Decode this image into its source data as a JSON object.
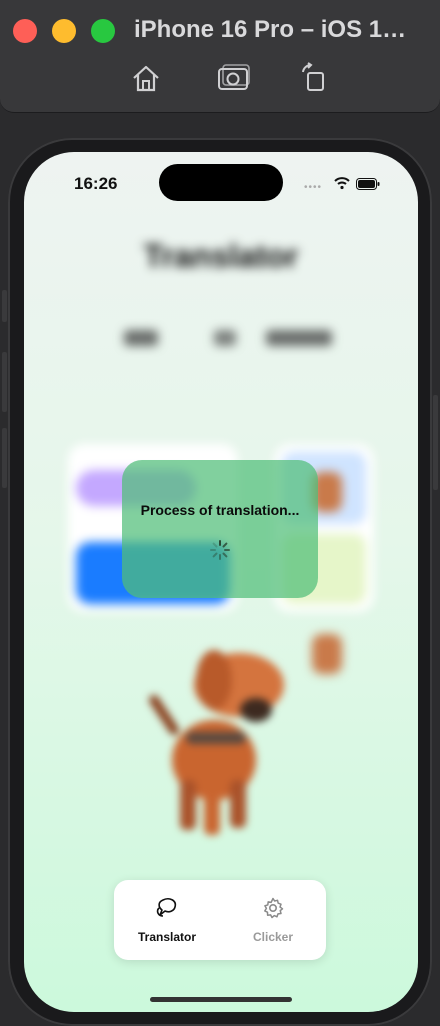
{
  "window": {
    "title": "iPhone 16 Pro – iOS 1…",
    "toolbar": {
      "home_icon": "home-icon",
      "screenshot_icon": "camera-icon",
      "rotate_icon": "rotate-icon"
    }
  },
  "status_bar": {
    "time": "16:26",
    "signal": "••••"
  },
  "background_screen": {
    "title": "Translator"
  },
  "overlay": {
    "message": "Process of translation..."
  },
  "tabbar": {
    "tabs": [
      {
        "label": "Translator",
        "icon": "speech-bubble-icon",
        "active": true
      },
      {
        "label": "Clicker",
        "icon": "gear-icon",
        "active": false
      }
    ]
  },
  "colors": {
    "overlay": "#50be78",
    "accent_blue": "#1a7cff",
    "accent_purple": "#c4a8ff",
    "screen_gradient_top": "#eef3f1",
    "screen_gradient_bottom": "#ccf9dc"
  }
}
